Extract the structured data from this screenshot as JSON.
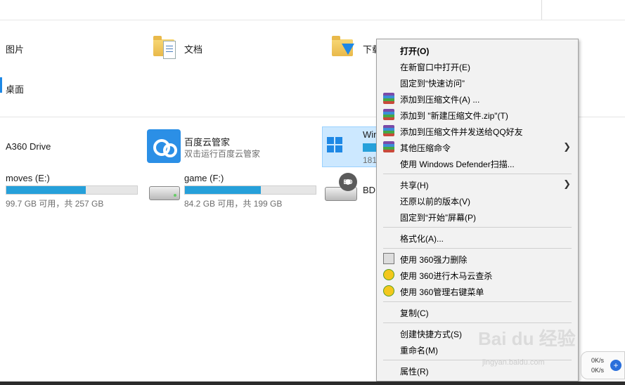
{
  "folders": [
    {
      "label": "图片"
    },
    {
      "label": "文档"
    },
    {
      "label": "下载"
    },
    {
      "label": "桌面"
    }
  ],
  "drives": {
    "a360": {
      "label": "A360 Drive"
    },
    "baidu": {
      "label": "百度云管家",
      "sub": "双击运行百度云管家"
    },
    "win": {
      "label": "Win",
      "sub": "181"
    },
    "moves": {
      "label": "moves (E:)",
      "sub": "99.7 GB 可用，共 257 GB",
      "used_fraction": 0.61
    },
    "game": {
      "label": "game (F:)",
      "sub": "84.2 GB 可用，共 199 GB",
      "used_fraction": 0.58
    },
    "bd": {
      "label": "BD",
      "badge": "BD"
    }
  },
  "context_menu": {
    "open": "打开(O)",
    "open_new_window": "在新窗口中打开(E)",
    "pin_quick_access": "固定到“快速访问”",
    "add_archive": "添加到压缩文件(A) ...",
    "add_zip": "添加到 \"新建压缩文件.zip\"(T)",
    "add_send_qq": "添加到压缩文件并发送给QQ好友",
    "other_compress": "其他压缩命令",
    "defender_scan": "使用 Windows Defender扫描...",
    "share": "共享(H)",
    "restore_versions": "还原以前的版本(V)",
    "pin_start": "固定到“开始”屏幕(P)",
    "format": "格式化(A)...",
    "shred_360": "使用 360强力删除",
    "trojan_360": "使用 360进行木马云查杀",
    "manage_360": "使用 360管理右键菜单",
    "copy": "复制(C)",
    "create_shortcut": "创建快捷方式(S)",
    "rename": "重命名(M)",
    "properties": "属性(R)"
  },
  "net_widget": {
    "up": "0K/s",
    "down": "0K/s"
  },
  "watermark": {
    "main": "Bai du 经验",
    "url": "jingyan.baidu.com"
  }
}
